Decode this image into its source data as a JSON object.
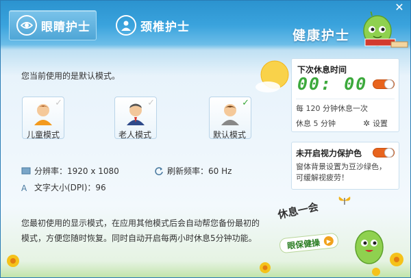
{
  "window": {
    "close_label": "✕"
  },
  "tabs": [
    {
      "label": "眼睛护士",
      "icon": "eye-icon",
      "active": true
    },
    {
      "label": "颈椎护士",
      "icon": "person-icon",
      "active": false
    }
  ],
  "brand": {
    "title": "健康护士"
  },
  "main": {
    "intro": "您当前使用的是默认模式。",
    "modes": [
      {
        "label": "儿童模式",
        "icon": "child-avatar-icon",
        "selected": false
      },
      {
        "label": "老人模式",
        "icon": "elder-avatar-icon",
        "selected": false
      },
      {
        "label": "默认模式",
        "icon": "default-avatar-icon",
        "selected": true
      }
    ],
    "resolution": "分辨率：1920 x 1080",
    "refresh": "刷新频率：60 Hz",
    "font_size": "文字大小(DPI)：96",
    "description": "您最初使用的显示模式，在应用其他模式后会自动帮您备份最初的模式，方便您随时恢复。同时自动开启每两小时休息5分钟功能。"
  },
  "rest_panel": {
    "title": "下次休息时间",
    "timer": "00: 00",
    "toggle_on": true,
    "interval": "每 120 分钟休息一次",
    "rest": "休息 5 分钟",
    "settings_label": "设置"
  },
  "color_panel": {
    "title": "未开启视力保护色",
    "toggle_on": true,
    "text": "窗体背景设置为豆沙绿色，可缓解视疲劳！"
  },
  "bottom": {
    "rest_text": "休息一会",
    "eye_button_label": "眼保健操"
  },
  "colors": {
    "accent": "#2b93cf",
    "timer_green": "#3ca93c",
    "toggle_orange": "#e8641e"
  }
}
